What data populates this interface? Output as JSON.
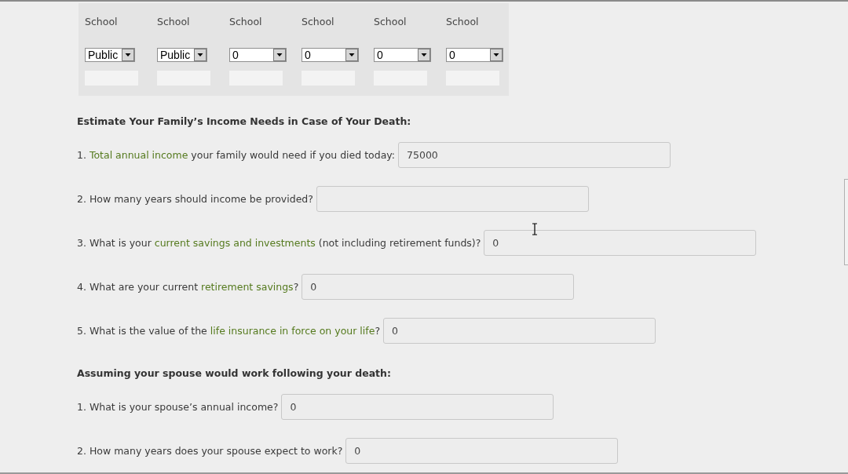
{
  "schools": [
    {
      "label": "School",
      "value": "Public"
    },
    {
      "label": "School",
      "value": "Public"
    },
    {
      "label": "School",
      "value": "0"
    },
    {
      "label": "School",
      "value": "0"
    },
    {
      "label": "School",
      "value": "0"
    },
    {
      "label": "School",
      "value": "0"
    }
  ],
  "sections": [
    {
      "heading": "Estimate Your Family’s Income Needs in Case of Your Death:",
      "questions": [
        {
          "parts": [
            {
              "text": "1. ",
              "highlight": false
            },
            {
              "text": "Total annual income",
              "highlight": true
            },
            {
              "text": " your family would need if you died today:",
              "highlight": false
            }
          ],
          "value": "75000"
        },
        {
          "parts": [
            {
              "text": "2. How many years should income be provided?",
              "highlight": false
            }
          ]
        },
        {
          "parts": [
            {
              "text": "3. What is your ",
              "highlight": false
            },
            {
              "text": "current savings and investments",
              "highlight": true
            },
            {
              "text": " (not including retirement funds)?",
              "highlight": false
            }
          ],
          "value": "0"
        },
        {
          "parts": [
            {
              "text": "4. What are your current ",
              "highlight": false
            },
            {
              "text": "retirement savings",
              "highlight": true
            },
            {
              "text": "?",
              "highlight": false
            }
          ],
          "value": "0"
        },
        {
          "parts": [
            {
              "text": "5. What is the value of the ",
              "highlight": false
            },
            {
              "text": "life insurance in force on your life",
              "highlight": true
            },
            {
              "text": "?",
              "highlight": false
            }
          ],
          "value": "0"
        }
      ]
    },
    {
      "heading": "Assuming your spouse would work following your death:",
      "questions": [
        {
          "parts": [
            {
              "text": "1. What is your spouse’s annual income?",
              "highlight": false
            }
          ],
          "value": "0"
        },
        {
          "parts": [
            {
              "text": "2. How many years does your spouse expect to work?",
              "highlight": false
            }
          ],
          "value": "0"
        }
      ]
    }
  ]
}
